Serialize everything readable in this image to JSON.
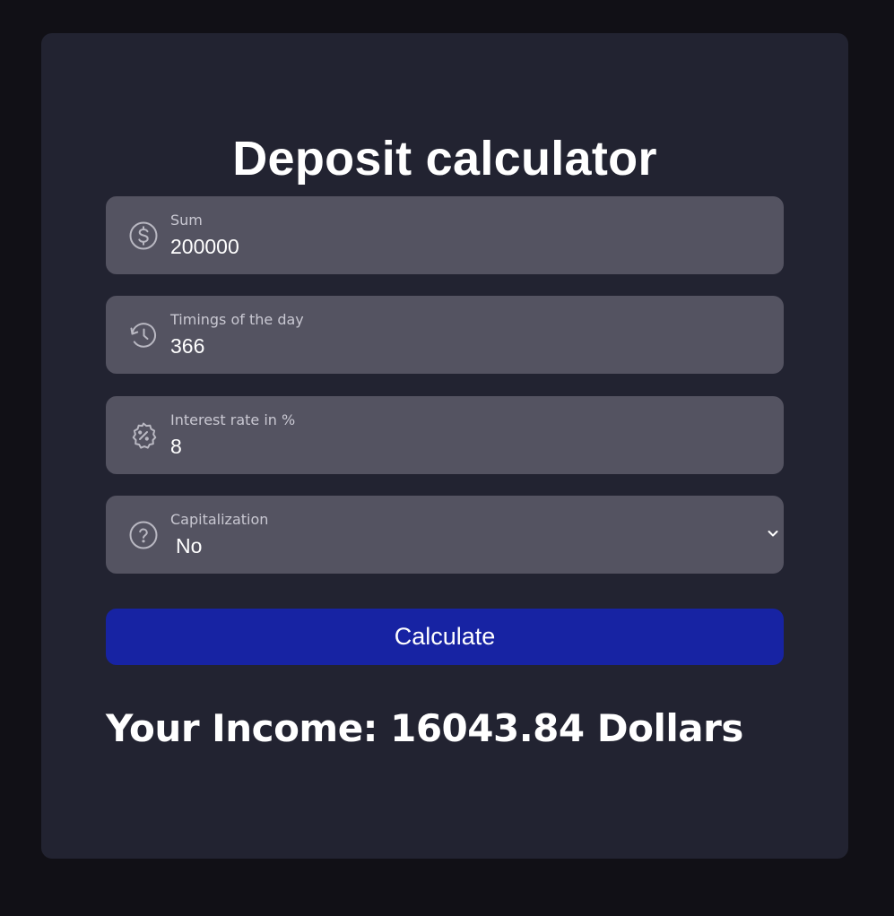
{
  "title": "Deposit calculator",
  "fields": [
    {
      "label": "Sum",
      "value": "200000",
      "icon": "dollar-circle-icon"
    },
    {
      "label": "Timings of the day",
      "value": "366",
      "icon": "history-icon"
    },
    {
      "label": "Interest rate in %",
      "value": "8",
      "icon": "percent-badge-icon"
    }
  ],
  "capitalization": {
    "label": "Capitalization",
    "value": "No",
    "icon": "question-circle-icon"
  },
  "calculate_label": "Calculate",
  "result": {
    "prefix": "Your Income:",
    "amount": "16043.84",
    "unit": "Dollars"
  },
  "colors": {
    "page_background": "#111016",
    "card_background": "#222331",
    "field_background": "#545361",
    "button_background": "#1723a3",
    "text": "#ffffff",
    "label_text": "#c9c8d2"
  }
}
